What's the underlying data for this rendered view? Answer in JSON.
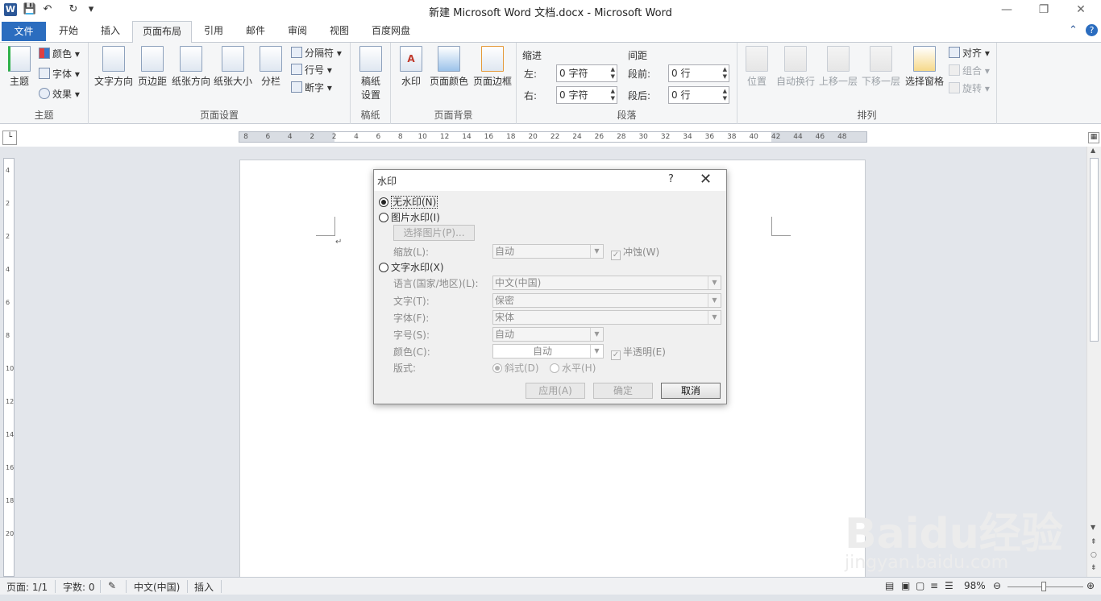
{
  "window": {
    "title": "新建 Microsoft Word 文档.docx  -  Microsoft Word",
    "app_icon": "W",
    "quick_access": [
      "save-icon",
      "undo-icon",
      "redo-icon",
      "customize-icon"
    ]
  },
  "tabs": [
    "文件",
    "开始",
    "插入",
    "页面布局",
    "引用",
    "邮件",
    "审阅",
    "视图",
    "百度网盘"
  ],
  "active_tab": "页面布局",
  "ribbon": {
    "theme": {
      "big": "主题",
      "colors": "颜色",
      "fonts": "字体",
      "effects": "效果",
      "group": "主题"
    },
    "page_setup": {
      "text_direction": "文字方向",
      "margins": "页边距",
      "orientation": "纸张方向",
      "size": "纸张大小",
      "columns": "分栏",
      "breaks": "分隔符",
      "line_numbers": "行号",
      "hyphenation": "断字",
      "group": "页面设置"
    },
    "draft": {
      "btn1": "稿纸",
      "btn2": "设置",
      "group": "稿纸"
    },
    "page_background": {
      "watermark": "水印",
      "page_color": "页面颜色",
      "page_borders": "页面边框",
      "group": "页面背景"
    },
    "paragraph": {
      "indent_header": "缩进",
      "spacing_header": "间距",
      "left_label": "左:",
      "left_value": "0 字符",
      "right_label": "右:",
      "right_value": "0 字符",
      "before_label": "段前:",
      "before_value": "0 行",
      "after_label": "段后:",
      "after_value": "0 行",
      "group": "段落"
    },
    "arrange": {
      "position": "位置",
      "wrap": "自动换行",
      "forward": "上移一层",
      "backward": "下移一层",
      "selection_pane": "选择窗格",
      "align": "对齐",
      "group_btn": "组合",
      "rotate": "旋转",
      "group": "排列"
    }
  },
  "ruler": {
    "ticks": [
      "8",
      "6",
      "4",
      "2",
      "2",
      "4",
      "6",
      "8",
      "10",
      "12",
      "14",
      "16",
      "18",
      "20",
      "22",
      "24",
      "26",
      "28",
      "30",
      "32",
      "34",
      "36",
      "38",
      "40",
      "42",
      "44",
      "46",
      "48"
    ]
  },
  "vruler_ticks": [
    "4",
    "2",
    "2",
    "4",
    "6",
    "8",
    "10",
    "12",
    "14",
    "16",
    "18",
    "20"
  ],
  "dialog": {
    "title": "水印",
    "help": "?",
    "close": "✕",
    "no_watermark": "无水印(N)",
    "picture_watermark": "图片水印(I)",
    "select_picture": "选择图片(P)...",
    "scale_label": "缩放(L):",
    "scale_value": "自动",
    "washout": "冲蚀(W)",
    "text_watermark": "文字水印(X)",
    "language_label": "语言(国家/地区)(L):",
    "language_value": "中文(中国)",
    "text_label": "文字(T):",
    "text_value": "保密",
    "font_label": "字体(F):",
    "font_value": "宋体",
    "size_label": "字号(S):",
    "size_value": "自动",
    "color_label": "颜色(C):",
    "color_value": "自动",
    "semitransparent": "半透明(E)",
    "layout_label": "版式:",
    "diagonal": "斜式(D)",
    "horizontal": "水平(H)",
    "apply": "应用(A)",
    "ok": "确定",
    "cancel": "取消"
  },
  "status": {
    "page": "页面: 1/1",
    "words": "字数: 0",
    "language": "中文(中国)",
    "mode": "插入",
    "zoom": "98%"
  },
  "watermark_overlay": {
    "brand": "Baidu经验",
    "url": "jingyan.baidu.com"
  },
  "colors": {
    "file_tab": "#2b6dbf",
    "accent": "#2b5797"
  }
}
